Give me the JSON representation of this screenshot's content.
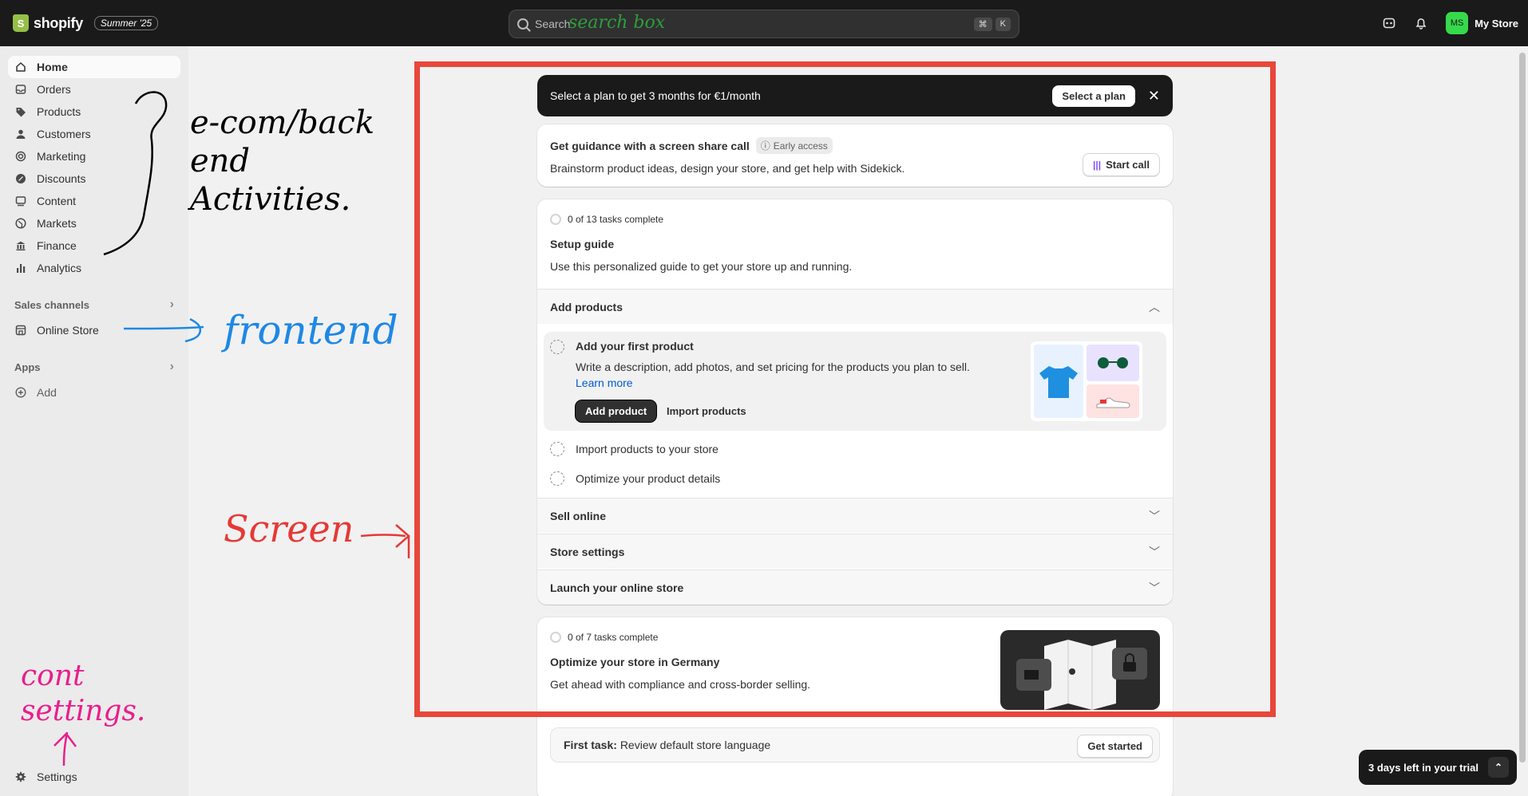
{
  "topbar": {
    "brand": "shopify",
    "edition": "Summer '25",
    "search_placeholder": "Search",
    "search_annotation": "search box",
    "kbd_cmd": "⌘",
    "kbd_k": "K",
    "store_initials": "MS",
    "store_name": "My Store"
  },
  "sidebar": {
    "items": [
      {
        "label": "Home",
        "icon": "home-icon"
      },
      {
        "label": "Orders",
        "icon": "inbox-icon"
      },
      {
        "label": "Products",
        "icon": "tag-icon"
      },
      {
        "label": "Customers",
        "icon": "person-icon"
      },
      {
        "label": "Marketing",
        "icon": "target-icon"
      },
      {
        "label": "Discounts",
        "icon": "discount-icon"
      },
      {
        "label": "Content",
        "icon": "content-icon"
      },
      {
        "label": "Markets",
        "icon": "globe-icon"
      },
      {
        "label": "Finance",
        "icon": "bank-icon"
      },
      {
        "label": "Analytics",
        "icon": "bar-chart-icon"
      }
    ],
    "sales_channels_label": "Sales channels",
    "online_store_label": "Online Store",
    "apps_label": "Apps",
    "add_label": "Add",
    "settings_label": "Settings"
  },
  "banner": {
    "text": "Select a plan to get 3 months for €1/month",
    "button": "Select a plan"
  },
  "guidance": {
    "title": "Get guidance with a screen share call",
    "badge": "Early access",
    "subtitle": "Brainstorm product ideas, design your store, and get help with Sidekick.",
    "button": "Start call"
  },
  "setup": {
    "progress": "0 of 13 tasks complete",
    "title": "Setup guide",
    "subtitle": "Use this personalized guide to get your store up and running.",
    "section_add_products": "Add products",
    "active_task": {
      "title": "Add your first product",
      "description": "Write a description, add photos, and set pricing for the products you plan to sell.",
      "link": "Learn more",
      "primary": "Add product",
      "secondary": "Import products"
    },
    "tasks": [
      "Import products to your store",
      "Optimize your product details"
    ],
    "sections": [
      "Sell online",
      "Store settings",
      "Launch your online store"
    ]
  },
  "germany": {
    "progress": "0 of 7 tasks complete",
    "title": "Optimize your store in Germany",
    "subtitle": "Get ahead with compliance and cross-border selling.",
    "first_task_label": "First task:",
    "first_task_text": "Review default store language",
    "button": "Get started"
  },
  "trial": {
    "text": "3 days left in your trial"
  },
  "annotations": {
    "ecom": "e-com/back end Activities.",
    "frontend": "frontend",
    "screen": "Screen",
    "settings": "cont settings."
  },
  "colors": {
    "topbar": "#1a1a1a",
    "frame": "#e8473a",
    "annot_black": "#000000",
    "annot_blue": "#1e88e5",
    "annot_red": "#e53935",
    "annot_pink": "#e91e8c",
    "annot_green": "#2e9d3c"
  }
}
